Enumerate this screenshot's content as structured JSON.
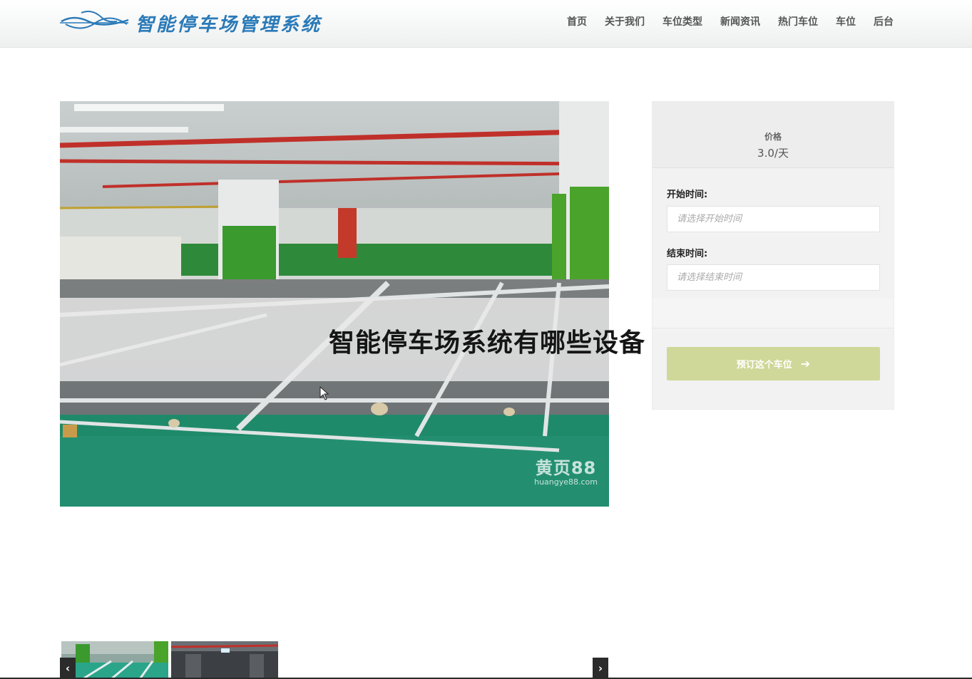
{
  "header": {
    "logo_text": "智能停车场管理系统",
    "nav": [
      "首页",
      "关于我们",
      "车位类型",
      "新闻资讯",
      "热门车位",
      "车位",
      "后台"
    ]
  },
  "main": {
    "image_watermark": "黄页88",
    "image_watermark_sub": "huangye88.com",
    "banner_title": "智能停车场系统有哪些设备"
  },
  "booking": {
    "price_label": "价格",
    "price_value": "3.0/天",
    "start_label": "开始时间:",
    "start_placeholder": "请选择开始时间",
    "end_label": "结束时间:",
    "end_placeholder": "请选择结束时间",
    "button_label": "预订这个车位",
    "button_icon": "arrow-right-icon",
    "button_color": "#cfd898"
  },
  "thumbnails": {
    "prev_icon": "‹",
    "next_icon": "›"
  }
}
